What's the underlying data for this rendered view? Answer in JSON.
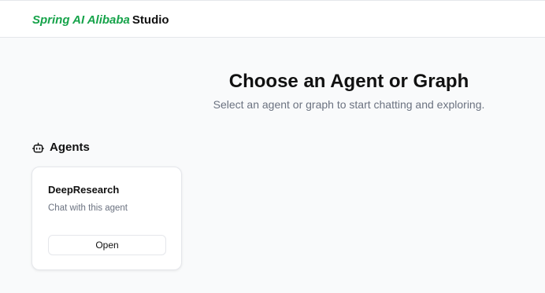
{
  "header": {
    "brand_primary": "Spring AI Alibaba",
    "brand_secondary": "Studio"
  },
  "main": {
    "title": "Choose an Agent or Graph",
    "subtitle": "Select an agent or graph to start chatting and exploring."
  },
  "agents_section": {
    "icon": "bot-icon",
    "label": "Agents",
    "cards": [
      {
        "name": "DeepResearch",
        "description": "Chat with this agent",
        "button_label": "Open"
      }
    ]
  },
  "colors": {
    "brand_green": "#16a34a",
    "background": "#f9fafb",
    "card_background": "#ffffff",
    "muted_text": "#6b7280",
    "border": "#e5e7eb"
  }
}
